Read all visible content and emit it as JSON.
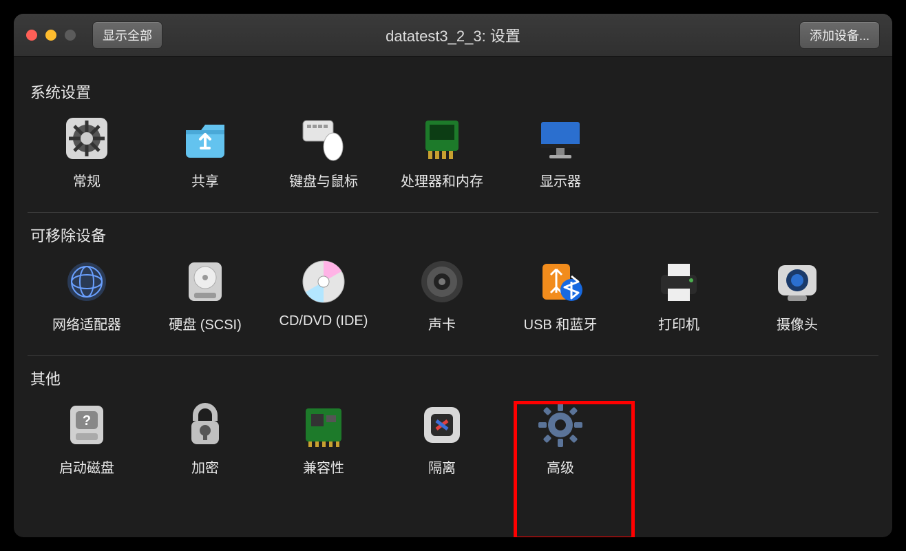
{
  "toolbar": {
    "show_all_label": "显示全部",
    "window_title": "datatest3_2_3: 设置",
    "add_device_label": "添加设备..."
  },
  "sections": {
    "system": {
      "title": "系统设置",
      "items": {
        "general": "常规",
        "sharing": "共享",
        "keyboard_mouse": "键盘与鼠标",
        "cpu_memory": "处理器和内存",
        "display": "显示器"
      }
    },
    "removable": {
      "title": "可移除设备",
      "items": {
        "network_adapter": "网络适配器",
        "hard_disk": "硬盘 (SCSI)",
        "cddvd": "CD/DVD (IDE)",
        "sound": "声卡",
        "usb_bt": "USB 和蓝牙",
        "printer": "打印机",
        "camera": "摄像头"
      }
    },
    "other": {
      "title": "其他",
      "items": {
        "startup_disk": "启动磁盘",
        "encryption": "加密",
        "compatibility": "兼容性",
        "isolation": "隔离",
        "advanced": "高级"
      }
    }
  },
  "highlight": {
    "target": "advanced"
  }
}
